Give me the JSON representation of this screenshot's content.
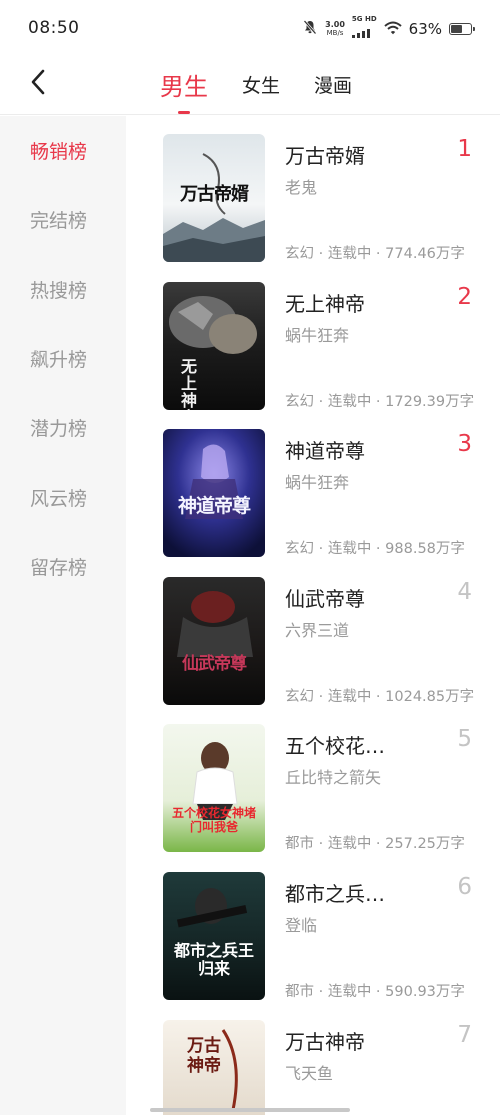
{
  "status_bar": {
    "time": "08:50",
    "net_speed_value": "3.00",
    "net_speed_unit": "MB/s",
    "signal_label": "5G HD",
    "battery_percent": "63%",
    "battery_level": 0.63
  },
  "header": {
    "tabs": [
      {
        "label": "男生",
        "active": true
      },
      {
        "label": "女生",
        "active": false
      },
      {
        "label": "漫画",
        "active": false
      }
    ]
  },
  "sidebar": {
    "items": [
      {
        "label": "畅销榜",
        "active": true
      },
      {
        "label": "完结榜",
        "active": false
      },
      {
        "label": "热搜榜",
        "active": false
      },
      {
        "label": "飙升榜",
        "active": false
      },
      {
        "label": "潜力榜",
        "active": false
      },
      {
        "label": "风云榜",
        "active": false
      },
      {
        "label": "留存榜",
        "active": false
      }
    ]
  },
  "books": [
    {
      "rank": "1",
      "title": "万古帝婿",
      "author": "老鬼",
      "meta": "玄幻 · 连载中 · 774.46万字",
      "cover_text": "万古帝婿"
    },
    {
      "rank": "2",
      "title": "无上神帝",
      "author": "蜗牛狂奔",
      "meta": "玄幻 · 连载中 · 1729.39万字",
      "cover_text": "无上神帝"
    },
    {
      "rank": "3",
      "title": "神道帝尊",
      "author": "蜗牛狂奔",
      "meta": "玄幻 · 连载中 · 988.58万字",
      "cover_text": "神道帝尊"
    },
    {
      "rank": "4",
      "title": "仙武帝尊",
      "author": "六界三道",
      "meta": "玄幻 · 连载中 · 1024.85万字",
      "cover_text": "仙武帝尊"
    },
    {
      "rank": "5",
      "title": "五个校花…",
      "author": "丘比特之箭矢",
      "meta": "都市 · 连载中 · 257.25万字",
      "cover_text": "五个校花女神堵门叫我爸"
    },
    {
      "rank": "6",
      "title": "都市之兵…",
      "author": "登临",
      "meta": "都市 · 连载中 · 590.93万字",
      "cover_text": "都市之兵王归来"
    },
    {
      "rank": "7",
      "title": "万古神帝",
      "author": "飞天鱼",
      "meta": "",
      "cover_text": "万古神帝"
    }
  ],
  "colors": {
    "accent": "#e8384a",
    "muted": "#9a9a9a",
    "rank_muted": "#c4c4c4",
    "sidebar_bg": "#f6f6f6"
  }
}
